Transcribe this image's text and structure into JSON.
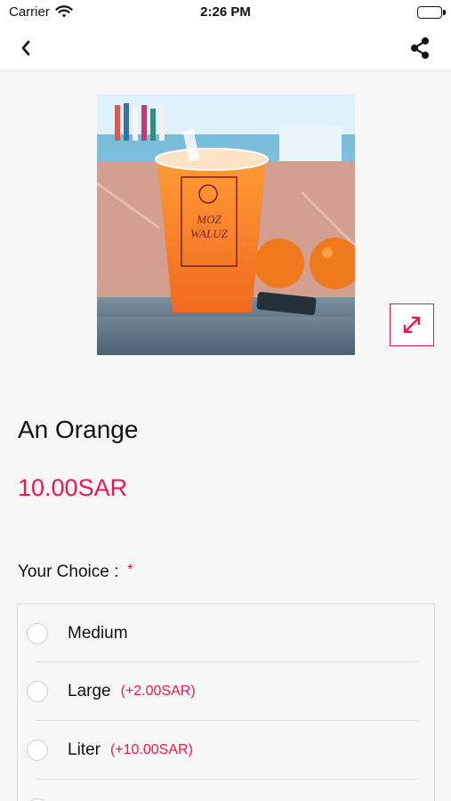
{
  "status_bar": {
    "carrier": "Carrier",
    "time": "2:26 PM"
  },
  "nav": {
    "back_icon": "chevron-left-icon",
    "share_icon": "share-icon"
  },
  "product": {
    "image_desc": "Orange juice cup",
    "cup_brand_line1": "MOZ",
    "cup_brand_line2": "WALUZ",
    "title": "An Orange",
    "price": "10.00SAR"
  },
  "choice": {
    "heading": "Your Choice :",
    "required_mark": "*",
    "options": [
      {
        "label": "Medium",
        "extra": ""
      },
      {
        "label": "Large",
        "extra": "(+2.00SAR)"
      },
      {
        "label": "Liter",
        "extra": "(+10.00SAR)"
      }
    ]
  },
  "colors": {
    "accent": "#e8194d",
    "background": "#f7f7f7"
  }
}
